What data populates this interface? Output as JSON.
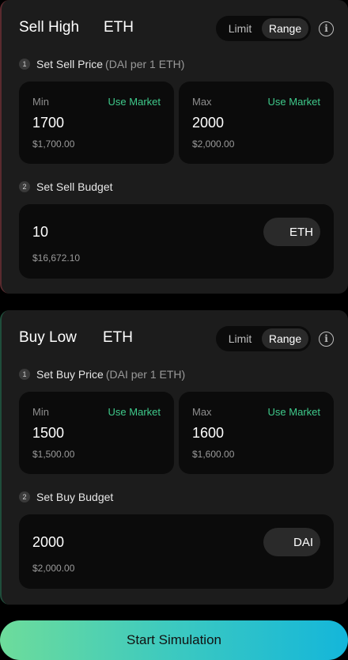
{
  "sell": {
    "title": "Sell High",
    "token": "ETH",
    "toggle": {
      "limit": "Limit",
      "range": "Range"
    },
    "info": "i",
    "step1": {
      "num": "1",
      "label": "Set Sell Price",
      "sub": "(DAI per 1 ETH)"
    },
    "min": {
      "caption": "Min",
      "market": "Use Market",
      "value": "1700",
      "usd": "$1,700.00"
    },
    "max": {
      "caption": "Max",
      "market": "Use Market",
      "value": "2000",
      "usd": "$2,000.00"
    },
    "step2": {
      "num": "2",
      "label": "Set Sell Budget"
    },
    "budget": {
      "value": "10",
      "usd": "$16,672.10",
      "token": "ETH"
    }
  },
  "buy": {
    "title": "Buy Low",
    "token": "ETH",
    "toggle": {
      "limit": "Limit",
      "range": "Range"
    },
    "info": "i",
    "step1": {
      "num": "1",
      "label": "Set Buy Price",
      "sub": "(DAI per 1 ETH)"
    },
    "min": {
      "caption": "Min",
      "market": "Use Market",
      "value": "1500",
      "usd": "$1,500.00"
    },
    "max": {
      "caption": "Max",
      "market": "Use Market",
      "value": "1600",
      "usd": "$1,600.00"
    },
    "step2": {
      "num": "2",
      "label": "Set Buy Budget"
    },
    "budget": {
      "value": "2000",
      "usd": "$2,000.00",
      "token": "DAI"
    }
  },
  "actions": {
    "start": "Start Simulation"
  },
  "colors": {
    "accent_green": "#3fca8b",
    "gradient_start": "#6ddc9b",
    "gradient_end": "#14b6da"
  }
}
